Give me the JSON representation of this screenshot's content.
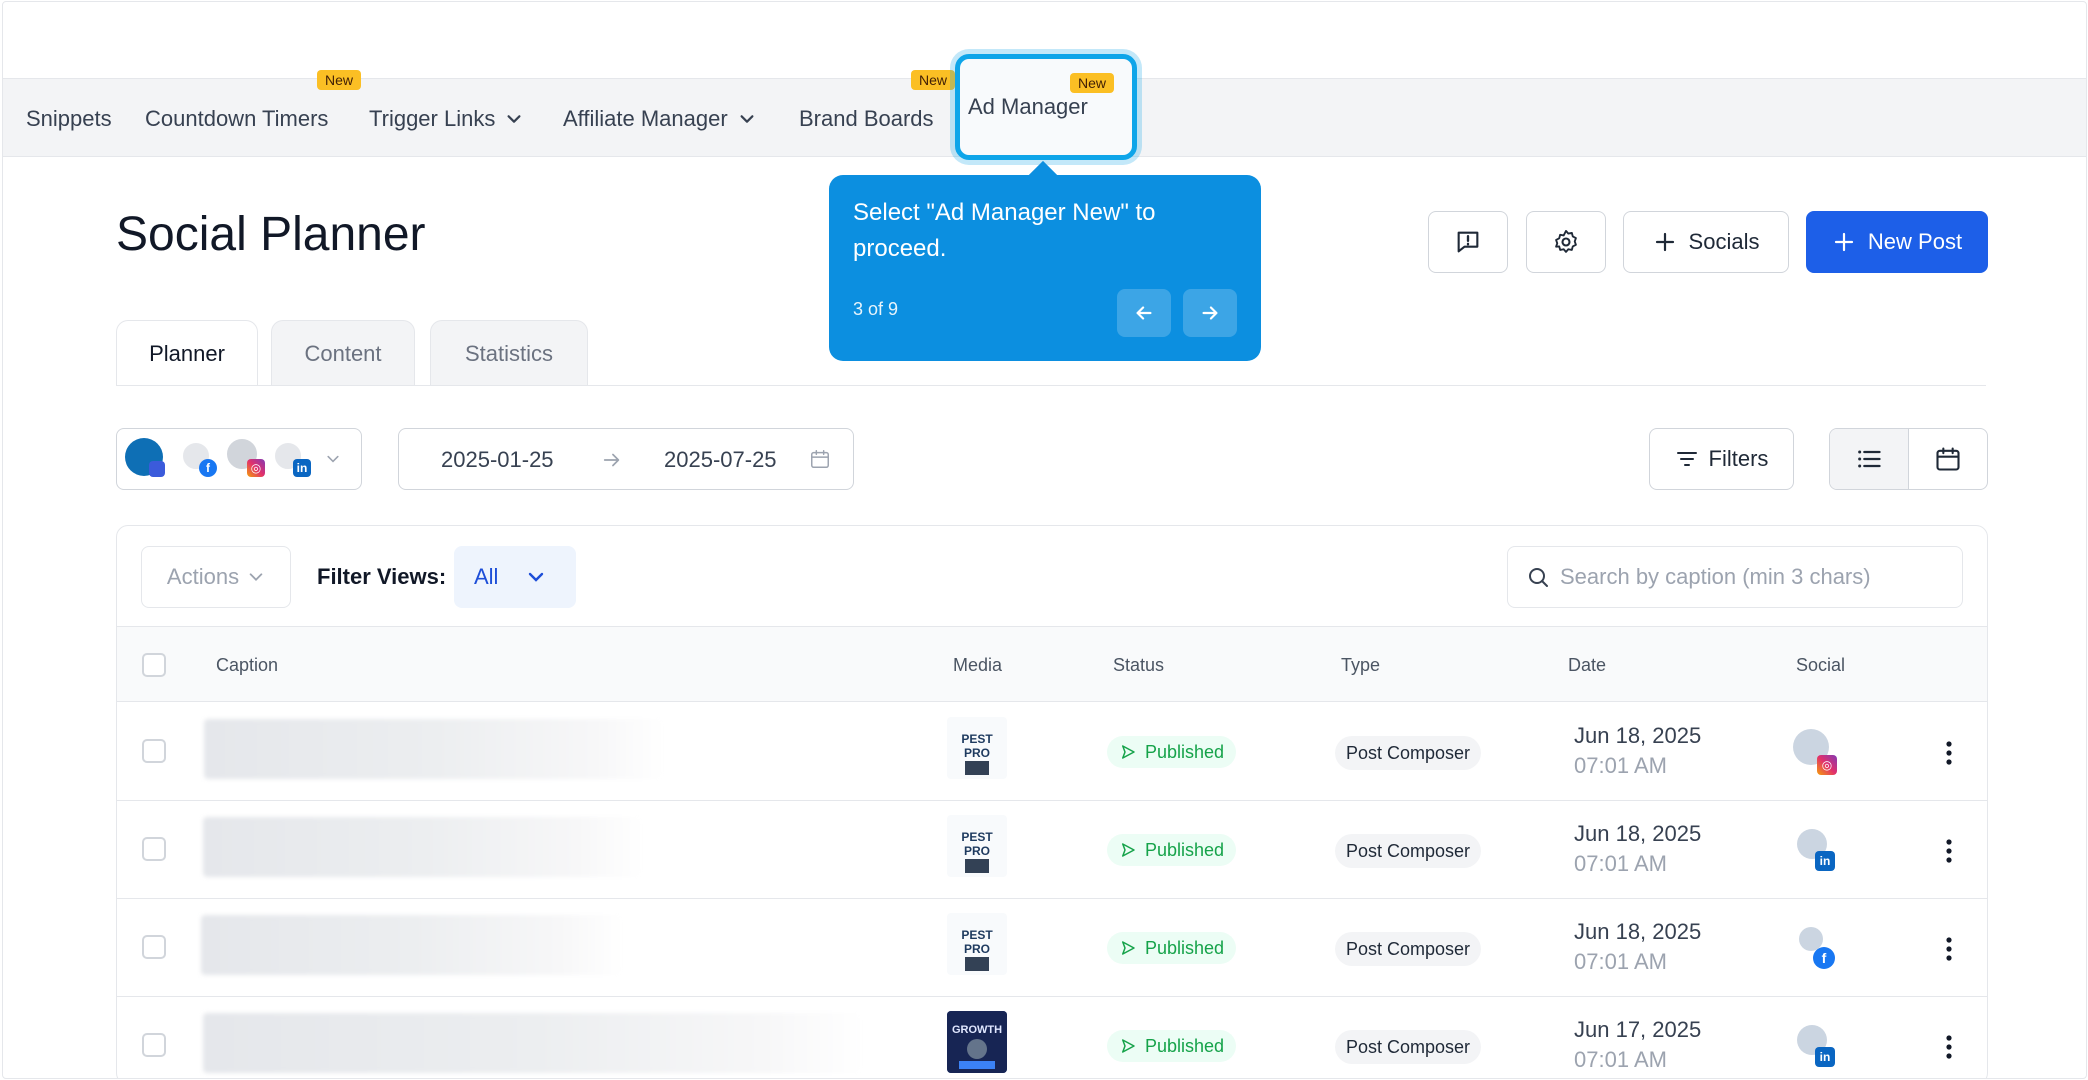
{
  "nav": {
    "items": [
      {
        "label": "Snippets"
      },
      {
        "label": "Countdown Timers",
        "badge": "New"
      },
      {
        "label": "Trigger Links"
      },
      {
        "label": "Affiliate Manager"
      },
      {
        "label": "Brand Boards",
        "badge": "New"
      },
      {
        "label": "Ad Manager",
        "badge": "New"
      }
    ]
  },
  "tour": {
    "message": "Select \"Ad Manager New\" to proceed.",
    "step": "3 of 9"
  },
  "header": {
    "title": "Social Planner",
    "socials_label": "Socials",
    "new_post_label": "New Post",
    "accent": "#1d5fe8"
  },
  "tabs": [
    {
      "label": "Planner",
      "active": true
    },
    {
      "label": "Content",
      "active": false
    },
    {
      "label": "Statistics",
      "active": false
    }
  ],
  "toolbar": {
    "start_date": "2025-01-25",
    "end_date": "2025-07-25",
    "filters_label": "Filters"
  },
  "table": {
    "actions_label": "Actions",
    "filter_views_label": "Filter Views:",
    "filter_views_value": "All",
    "search_placeholder": "Search by caption (min 3 chars)",
    "columns": [
      "Caption",
      "Media",
      "Status",
      "Type",
      "Date",
      "Social"
    ],
    "rows": [
      {
        "status": "Published",
        "type": "Post Composer",
        "date": "Jun 18, 2025",
        "time": "07:01 AM",
        "social": "instagram"
      },
      {
        "status": "Published",
        "type": "Post Composer",
        "date": "Jun 18, 2025",
        "time": "07:01 AM",
        "social": "linkedin"
      },
      {
        "status": "Published",
        "type": "Post Composer",
        "date": "Jun 18, 2025",
        "time": "07:01 AM",
        "social": "facebook"
      },
      {
        "status": "Published",
        "type": "Post Composer",
        "date": "Jun 17, 2025",
        "time": "07:01 AM",
        "social": "linkedin"
      }
    ]
  }
}
